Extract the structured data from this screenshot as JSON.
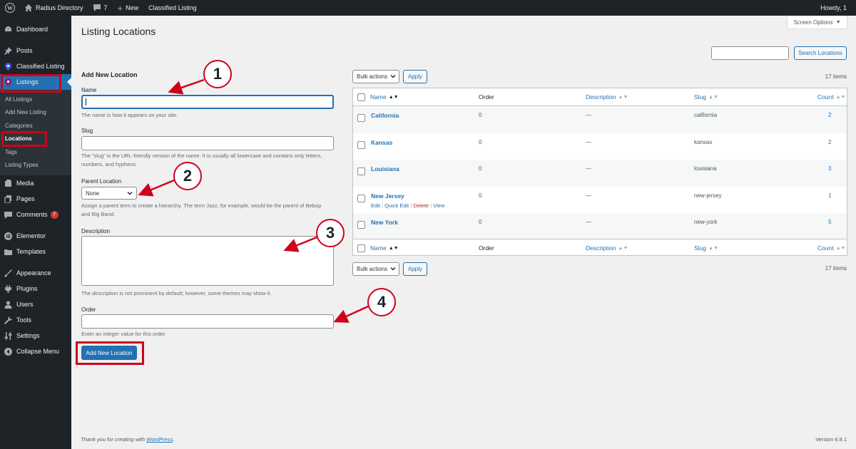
{
  "admin_bar": {
    "site_name": "Radius Directory",
    "comments_count": "7",
    "new_label": "New",
    "plugin_link": "Classified Listing",
    "howdy": "Howdy, 1"
  },
  "sidebar": {
    "items": [
      {
        "label": "Dashboard",
        "icon": "dashboard-icon"
      },
      {
        "label": "Posts",
        "icon": "pin-icon"
      },
      {
        "label": "Classified Listing",
        "icon": "location-pin-icon"
      },
      {
        "label": "Listings",
        "icon": "location-pin-icon"
      },
      {
        "label": "Media",
        "icon": "media-icon"
      },
      {
        "label": "Pages",
        "icon": "pages-icon"
      },
      {
        "label": "Comments",
        "icon": "comments-icon",
        "badge": "7"
      },
      {
        "label": "Elementor",
        "icon": "elementor-icon"
      },
      {
        "label": "Templates",
        "icon": "folder-icon"
      },
      {
        "label": "Appearance",
        "icon": "brush-icon"
      },
      {
        "label": "Plugins",
        "icon": "plugin-icon"
      },
      {
        "label": "Users",
        "icon": "users-icon"
      },
      {
        "label": "Tools",
        "icon": "wrench-icon"
      },
      {
        "label": "Settings",
        "icon": "settings-icon"
      },
      {
        "label": "Collapse Menu",
        "icon": "collapse-icon"
      }
    ],
    "submenu": [
      "All Listings",
      "Add New Listing",
      "Categories",
      "Locations",
      "Tags",
      "Listing Types"
    ]
  },
  "page": {
    "title": "Listing Locations",
    "screen_options": "Screen Options",
    "search_button": "Search Locations"
  },
  "form": {
    "heading": "Add New Location",
    "name_label": "Name",
    "name_desc": "The name is how it appears on your site.",
    "slug_label": "Slug",
    "slug_desc": "The “slug” is the URL-friendly version of the name. It is usually all lowercase and contains only letters, numbers, and hyphens.",
    "parent_label": "Parent Location",
    "parent_value": "None",
    "parent_desc": "Assign a parent term to create a hierarchy. The term Jazz, for example, would be the parent of Bebop and Big Band.",
    "description_label": "Description",
    "description_desc": "The description is not prominent by default; however, some themes may show it.",
    "order_label": "Order",
    "order_desc": "Enter an integer value for this order",
    "submit_label": "Add New Location"
  },
  "table": {
    "bulk_actions": "Bulk actions",
    "apply": "Apply",
    "items_count": "17 items",
    "columns": {
      "name": "Name",
      "order": "Order",
      "description": "Description",
      "slug": "Slug",
      "count": "Count"
    },
    "rows": [
      {
        "name": "California",
        "order": "0",
        "description": "—",
        "slug": "california",
        "count": "2"
      },
      {
        "name": "Kansas",
        "order": "0",
        "description": "—",
        "slug": "kansas",
        "count": "2"
      },
      {
        "name": "Louisiana",
        "order": "0",
        "description": "—",
        "slug": "louisiana",
        "count": "3"
      },
      {
        "name": "New Jersey",
        "order": "0",
        "description": "—",
        "slug": "new-jersey",
        "count": "1"
      },
      {
        "name": "New York",
        "order": "0",
        "description": "—",
        "slug": "new-york",
        "count": "5"
      }
    ],
    "row_actions": {
      "edit": "Edit",
      "quick_edit": "Quick Edit",
      "delete": "Delete",
      "view": "View",
      "separator": "|"
    }
  },
  "footer": {
    "thanks_prefix": "Thank you for creating with",
    "thanks_link": "WordPress",
    "thanks_suffix": ".",
    "version": "Version 6.8.1"
  },
  "annotations": [
    "1",
    "2",
    "3",
    "4"
  ],
  "colors": {
    "accent": "#2271b1",
    "highlight": "#d0021b",
    "admin_dark": "#1d2327"
  }
}
